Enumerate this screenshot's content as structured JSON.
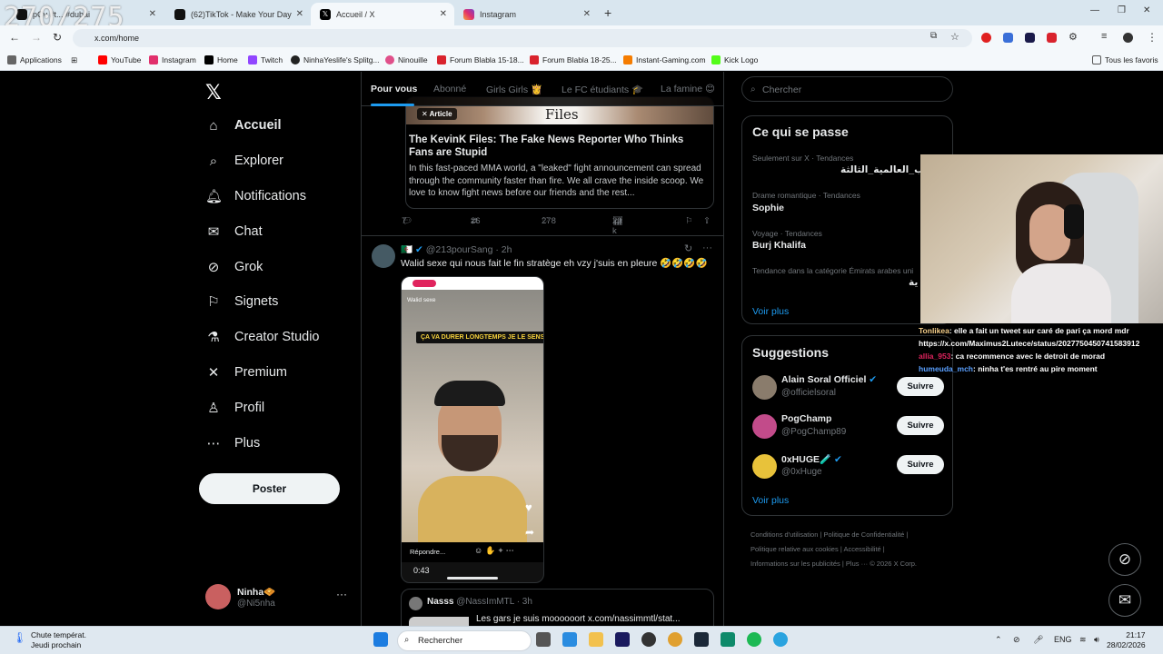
{
  "overlay_counter": "270/275",
  "browser": {
    "tabs": [
      {
        "label": "pCv #t... #dubai",
        "icon": "tiktok-icon"
      },
      {
        "label": "(62)TikTok - Make Your Day",
        "icon": "tiktok-icon"
      },
      {
        "label": "Accueil / X",
        "icon": "x-icon",
        "active": true
      },
      {
        "label": "Instagram",
        "icon": "instagram-icon"
      }
    ],
    "url": "x.com/home",
    "bookmarks": [
      "Applications",
      "YouTube",
      "Instagram",
      "Home",
      "Twitch",
      "NinhaYeslife's Splitg...",
      "Ninouille",
      "Forum Blabla 15-18...",
      "Forum Blabla 18-25...",
      "Instant-Gaming.com",
      "Kick Logo"
    ],
    "all_bookmarks": "Tous les favoris"
  },
  "nav": {
    "items": [
      "Accueil",
      "Explorer",
      "Notifications",
      "Chat",
      "Grok",
      "Signets",
      "Creator Studio",
      "Premium",
      "Profil",
      "Plus"
    ],
    "post_button": "Poster",
    "account_name": "Ninha🧇",
    "account_handle": "@Ni5nha"
  },
  "feed": {
    "tabs": [
      "Pour vous",
      "Abonné",
      "Girls Girls 👸",
      "Le FC étudiants 🎓",
      "La famine 😊"
    ],
    "article": {
      "badge": "✕ Article",
      "image_text": "Files",
      "title": "The KevinK Files: The Fake News Reporter Who Thinks Fans are Stupid",
      "body": "In this fast-paced MMA world, a \"leaked\" fight announcement can spread through the community faster than fire. We all crave the inside scoop. We love to know fight news before our friends and the rest..."
    },
    "article_actions": {
      "replies": "7",
      "reposts": "26",
      "likes": "278",
      "views": "29 k"
    },
    "tweet": {
      "handle": "@213pourSang",
      "time": "· 2h",
      "text": "Walid sexe qui nous fait le fin stratège eh vzy j'suis en pleure 🤣🤣🤣🤣"
    },
    "video": {
      "user": "Walid sexe",
      "caption": "ÇA VA DURER LONGTEMPS JE LE SENS",
      "reply": "Répondre...",
      "duration": "0:43"
    },
    "quote": {
      "name": "Nasss",
      "handle": "@NassImMTL",
      "time": "· 3h",
      "text": "Les gars je suis moooooort  x.com/nassimmtl/stat..."
    }
  },
  "sidebar": {
    "search_placeholder": "Chercher",
    "trends_title": "Ce qui se passe",
    "trends": [
      {
        "meta": "Seulement sur X · Tendances",
        "name": "ب_العالمية_الثالثة"
      },
      {
        "meta": "Drame romantique · Tendances",
        "name": "Sophie"
      },
      {
        "meta": "Voyage · Tendances",
        "name": "Burj Khalifa"
      },
      {
        "meta": "Tendance dans la catégorie Émirats arabes uni",
        "name": "ية"
      }
    ],
    "see_more": "Voir plus",
    "suggestions_title": "Suggestions",
    "suggestions": [
      {
        "name": "Alain Soral Officiel",
        "handle": "@officielsoral",
        "button": "Suivre"
      },
      {
        "name": "PogChamp",
        "handle": "@PogChamp89",
        "button": "Suivre"
      },
      {
        "name": "0xHUGE🧪",
        "handle": "@0xHuge",
        "button": "Suivre"
      }
    ],
    "footer": [
      "Conditions d'utilisation",
      "Politique de Confidentialité",
      "Politique relative aux cookies",
      "Accessibilité",
      "Informations sur les publicités",
      "Plus ···",
      "© 2026 X Corp."
    ]
  },
  "stream_chat": [
    {
      "user": "Tonlikea",
      "message": ": elle a fait un tweet sur caré de pari ça mord mdr https://x.com/Maximus2Lutece/status/2027750450741583912"
    },
    {
      "user": "allia_953",
      "message": ": ca recommence avec le detroit de morad"
    },
    {
      "user": "humeuda_mch",
      "message": ": ninha t'es rentré au pire moment"
    }
  ],
  "taskbar": {
    "weather_title": "Chute températ.",
    "weather_sub": "Jeudi prochain",
    "search": "Rechercher",
    "lang": "ENG",
    "time": "21:17",
    "date": "28/02/2026"
  }
}
